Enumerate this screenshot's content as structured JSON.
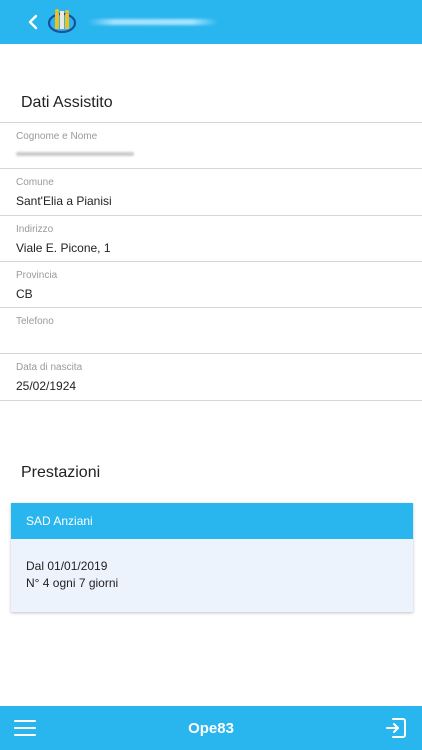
{
  "header": {
    "back_icon": "chevron-left-icon",
    "logo_icon": "app-logo-icon",
    "accent_color": "#29b6ef"
  },
  "dati_assistito": {
    "title": "Dati Assistito",
    "fields": [
      {
        "label": "Cognome e Nome",
        "value": ""
      },
      {
        "label": "Comune",
        "value": "Sant'Elia a Pianisi"
      },
      {
        "label": "Indirizzo",
        "value": "Viale E. Picone, 1"
      },
      {
        "label": "Provincia",
        "value": "CB"
      },
      {
        "label": "Telefono",
        "value": ""
      },
      {
        "label": "Data di nascita",
        "value": "25/02/1924"
      }
    ]
  },
  "prestazioni": {
    "title": "Prestazioni",
    "card": {
      "header": "SAD Anziani",
      "line1": "Dal 01/01/2019",
      "line2": "N° 4 ogni 7 giorni"
    }
  },
  "bottom_bar": {
    "menu_icon": "hamburger-menu-icon",
    "operator": "Ope83",
    "exit_icon": "logout-icon"
  }
}
